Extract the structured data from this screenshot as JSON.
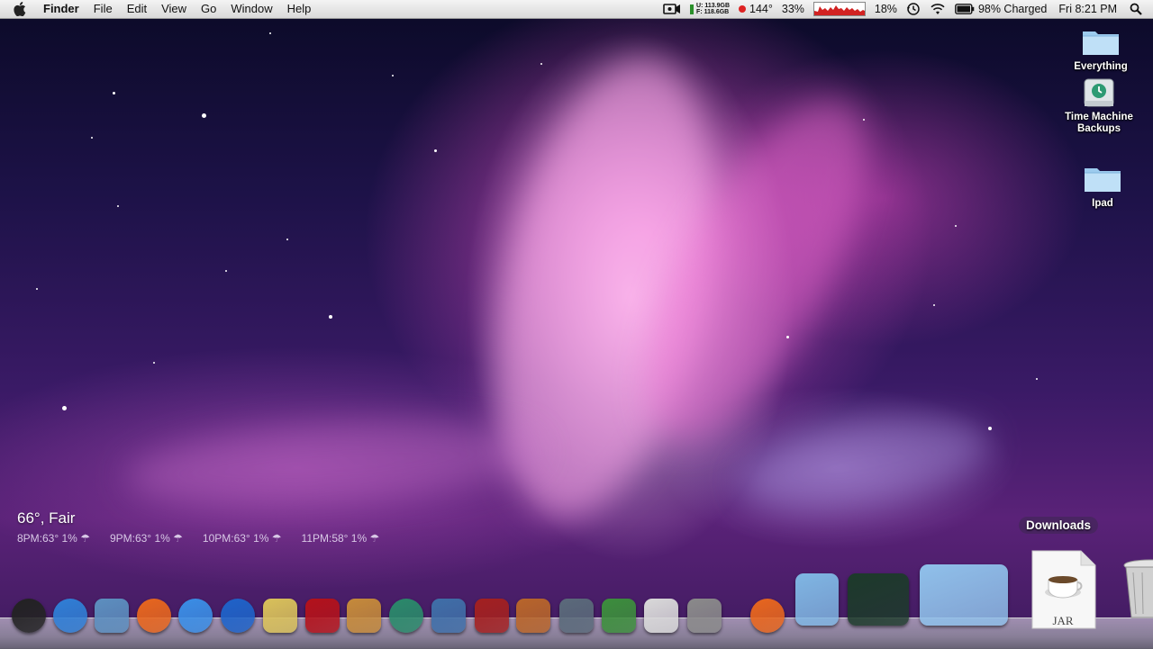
{
  "menubar": {
    "app_name": "Finder",
    "menus": [
      "File",
      "Edit",
      "View",
      "Go",
      "Window",
      "Help"
    ],
    "status": {
      "disk_u": "U: 113.9GB",
      "disk_f": "F: 118.6GB",
      "temperature": "144°",
      "cpu": "33%",
      "memory": "18%",
      "battery": "98% Charged",
      "clock": "Fri 8:21 PM"
    }
  },
  "desktop_icons": [
    {
      "label": "Everything",
      "icon": "folder-icon"
    },
    {
      "label": "Time Machine Backups",
      "icon": "time-machine-drive-icon"
    },
    {
      "label": "Ipad",
      "icon": "folder-icon"
    }
  ],
  "weather": {
    "current": "66°, Fair",
    "forecast": [
      "8PM:63° 1%",
      "9PM:63° 1%",
      "10PM:63° 1%",
      "11PM:58° 1%"
    ]
  },
  "dock": {
    "hover_label": "Downloads",
    "downloads_file_type": "JAR",
    "apps": [
      {
        "name": "dashboard-icon",
        "color": "#222222"
      },
      {
        "name": "safari-icon",
        "color": "#2f7fd6"
      },
      {
        "name": "preview-icon",
        "color": "#5c8fbf"
      },
      {
        "name": "firefox-icon",
        "color": "#e8661d"
      },
      {
        "name": "ichat-icon",
        "color": "#3a8ee6"
      },
      {
        "name": "itunes-icon",
        "color": "#1e63c9"
      },
      {
        "name": "imovie-icon",
        "color": "#d9c15a"
      },
      {
        "name": "photo-booth-icon",
        "color": "#b3121b"
      },
      {
        "name": "iphoto-icon",
        "color": "#c58a3a"
      },
      {
        "name": "time-machine-icon",
        "color": "#2a8a6a"
      },
      {
        "name": "screen-sharing-icon",
        "color": "#3f6fa8"
      },
      {
        "name": "dictionary-icon",
        "color": "#a32020"
      },
      {
        "name": "keynote-icon",
        "color": "#b8652a"
      },
      {
        "name": "pages-icon",
        "color": "#5a6a7a"
      },
      {
        "name": "numbers-icon",
        "color": "#3c8e3c"
      },
      {
        "name": "textedit-icon",
        "color": "#d9d9d9"
      },
      {
        "name": "system-preferences-icon",
        "color": "#8a8a8a"
      },
      {
        "name": "firefox-icon",
        "color": "#e8661d"
      },
      {
        "name": "applications-folder-icon",
        "color": "#7fb6e3"
      },
      {
        "name": "activity-monitor-icon",
        "color": "#1c3a2a"
      },
      {
        "name": "documents-folder-icon",
        "color": "#8fc0ea"
      },
      {
        "name": "downloads-stack-icon",
        "color": "#f2f2f2"
      },
      {
        "name": "trash-icon",
        "color": "#c8c8c8"
      }
    ]
  }
}
